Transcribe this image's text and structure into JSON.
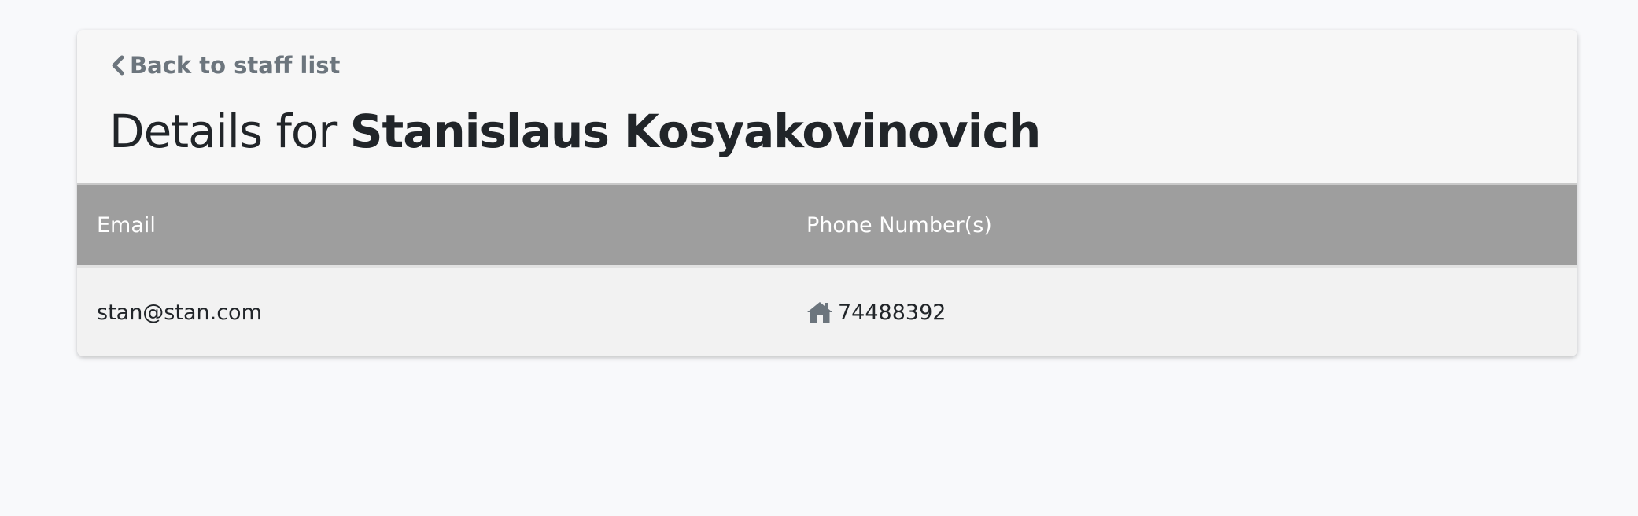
{
  "back_link": {
    "label": "Back to staff list",
    "icon": "chevron-left-icon"
  },
  "title": {
    "prefix": "Details for ",
    "name": "Stanislaus Kosyakovinovich"
  },
  "table": {
    "headers": [
      "Email",
      "Phone Number(s)"
    ],
    "rows": [
      {
        "email": "stan@stan.com",
        "phone_icon": "home-icon",
        "phone": "74488392"
      }
    ]
  },
  "colors": {
    "header_bg": "#9e9e9e",
    "link": "#6c757d",
    "text": "#212529"
  }
}
